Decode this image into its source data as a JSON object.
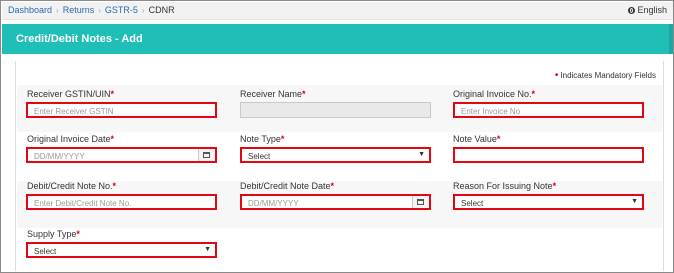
{
  "breadcrumb": {
    "items": [
      "Dashboard",
      "Returns",
      "GSTR-5"
    ],
    "current": "CDNR"
  },
  "language": {
    "label": "English",
    "icon": "globe-icon"
  },
  "header": {
    "title": "Credit/Debit Notes - Add",
    "color": "#1fbfb8"
  },
  "mandatory_note": "Indicates Mandatory Fields",
  "highlight_color": "#e30613",
  "form": {
    "receiver_gstin": {
      "label": "Receiver GSTIN/UIN",
      "placeholder": "Enter Receiver GSTIN"
    },
    "receiver_name": {
      "label": "Receiver Name",
      "value": ""
    },
    "original_invoice_no": {
      "label": "Original Invoice No.",
      "placeholder": "Enter Invoice No"
    },
    "original_invoice_date": {
      "label": "Original Invoice Date",
      "placeholder": "DD/MM/YYYY"
    },
    "note_type": {
      "label": "Note Type",
      "selected": "Select"
    },
    "note_value": {
      "label": "Note Value",
      "value": ""
    },
    "note_no": {
      "label": "Debit/Credit Note No.",
      "placeholder": "Enter Debit/Credit Note No."
    },
    "note_date": {
      "label": "Debit/Credit Note Date",
      "placeholder": "DD/MM/YYYY"
    },
    "reason": {
      "label": "Reason For Issuing Note",
      "selected": "Select"
    },
    "supply_type": {
      "label": "Supply Type",
      "selected": "Select"
    }
  }
}
